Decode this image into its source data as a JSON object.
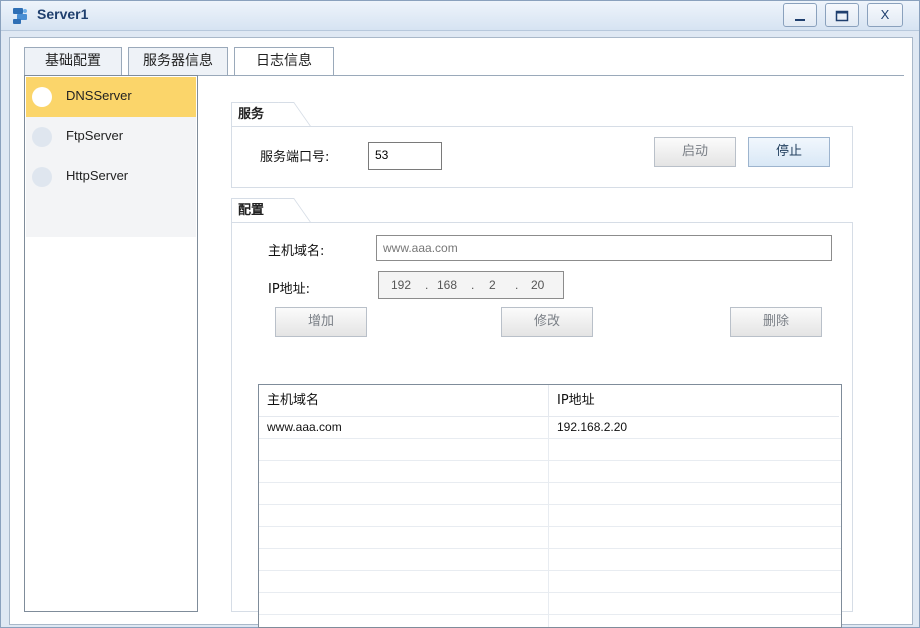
{
  "window": {
    "title": "Server1",
    "controls": {
      "minimize": "—",
      "maximize": "□",
      "close": "X"
    }
  },
  "tabs": [
    {
      "label": "基础配置",
      "active": false
    },
    {
      "label": "服务器信息",
      "active": true
    },
    {
      "label": "日志信息",
      "active": false
    }
  ],
  "server_list": [
    {
      "label": "DNSServer",
      "selected": true
    },
    {
      "label": "FtpServer",
      "selected": false
    },
    {
      "label": "HttpServer",
      "selected": false
    }
  ],
  "service_group": {
    "title": "服务",
    "port_label": "服务端口号:",
    "port_value": "53",
    "start_label": "启动",
    "stop_label": "停止"
  },
  "config_group": {
    "title": "配置",
    "host_label": "主机域名:",
    "host_placeholder": "www.aaa.com",
    "ip_label": "IP地址:",
    "ip_segments": [
      "192",
      "168",
      "2",
      "20"
    ],
    "ip_sep": ".",
    "add_label": "增加",
    "modify_label": "修改",
    "delete_label": "删除"
  },
  "table": {
    "columns": [
      "主机域名",
      "IP地址"
    ],
    "rows": [
      [
        "www.aaa.com",
        "192.168.2.20"
      ]
    ]
  },
  "colors": {
    "selected_item": "#fbd56a",
    "title_text": "#1f3f6e"
  }
}
